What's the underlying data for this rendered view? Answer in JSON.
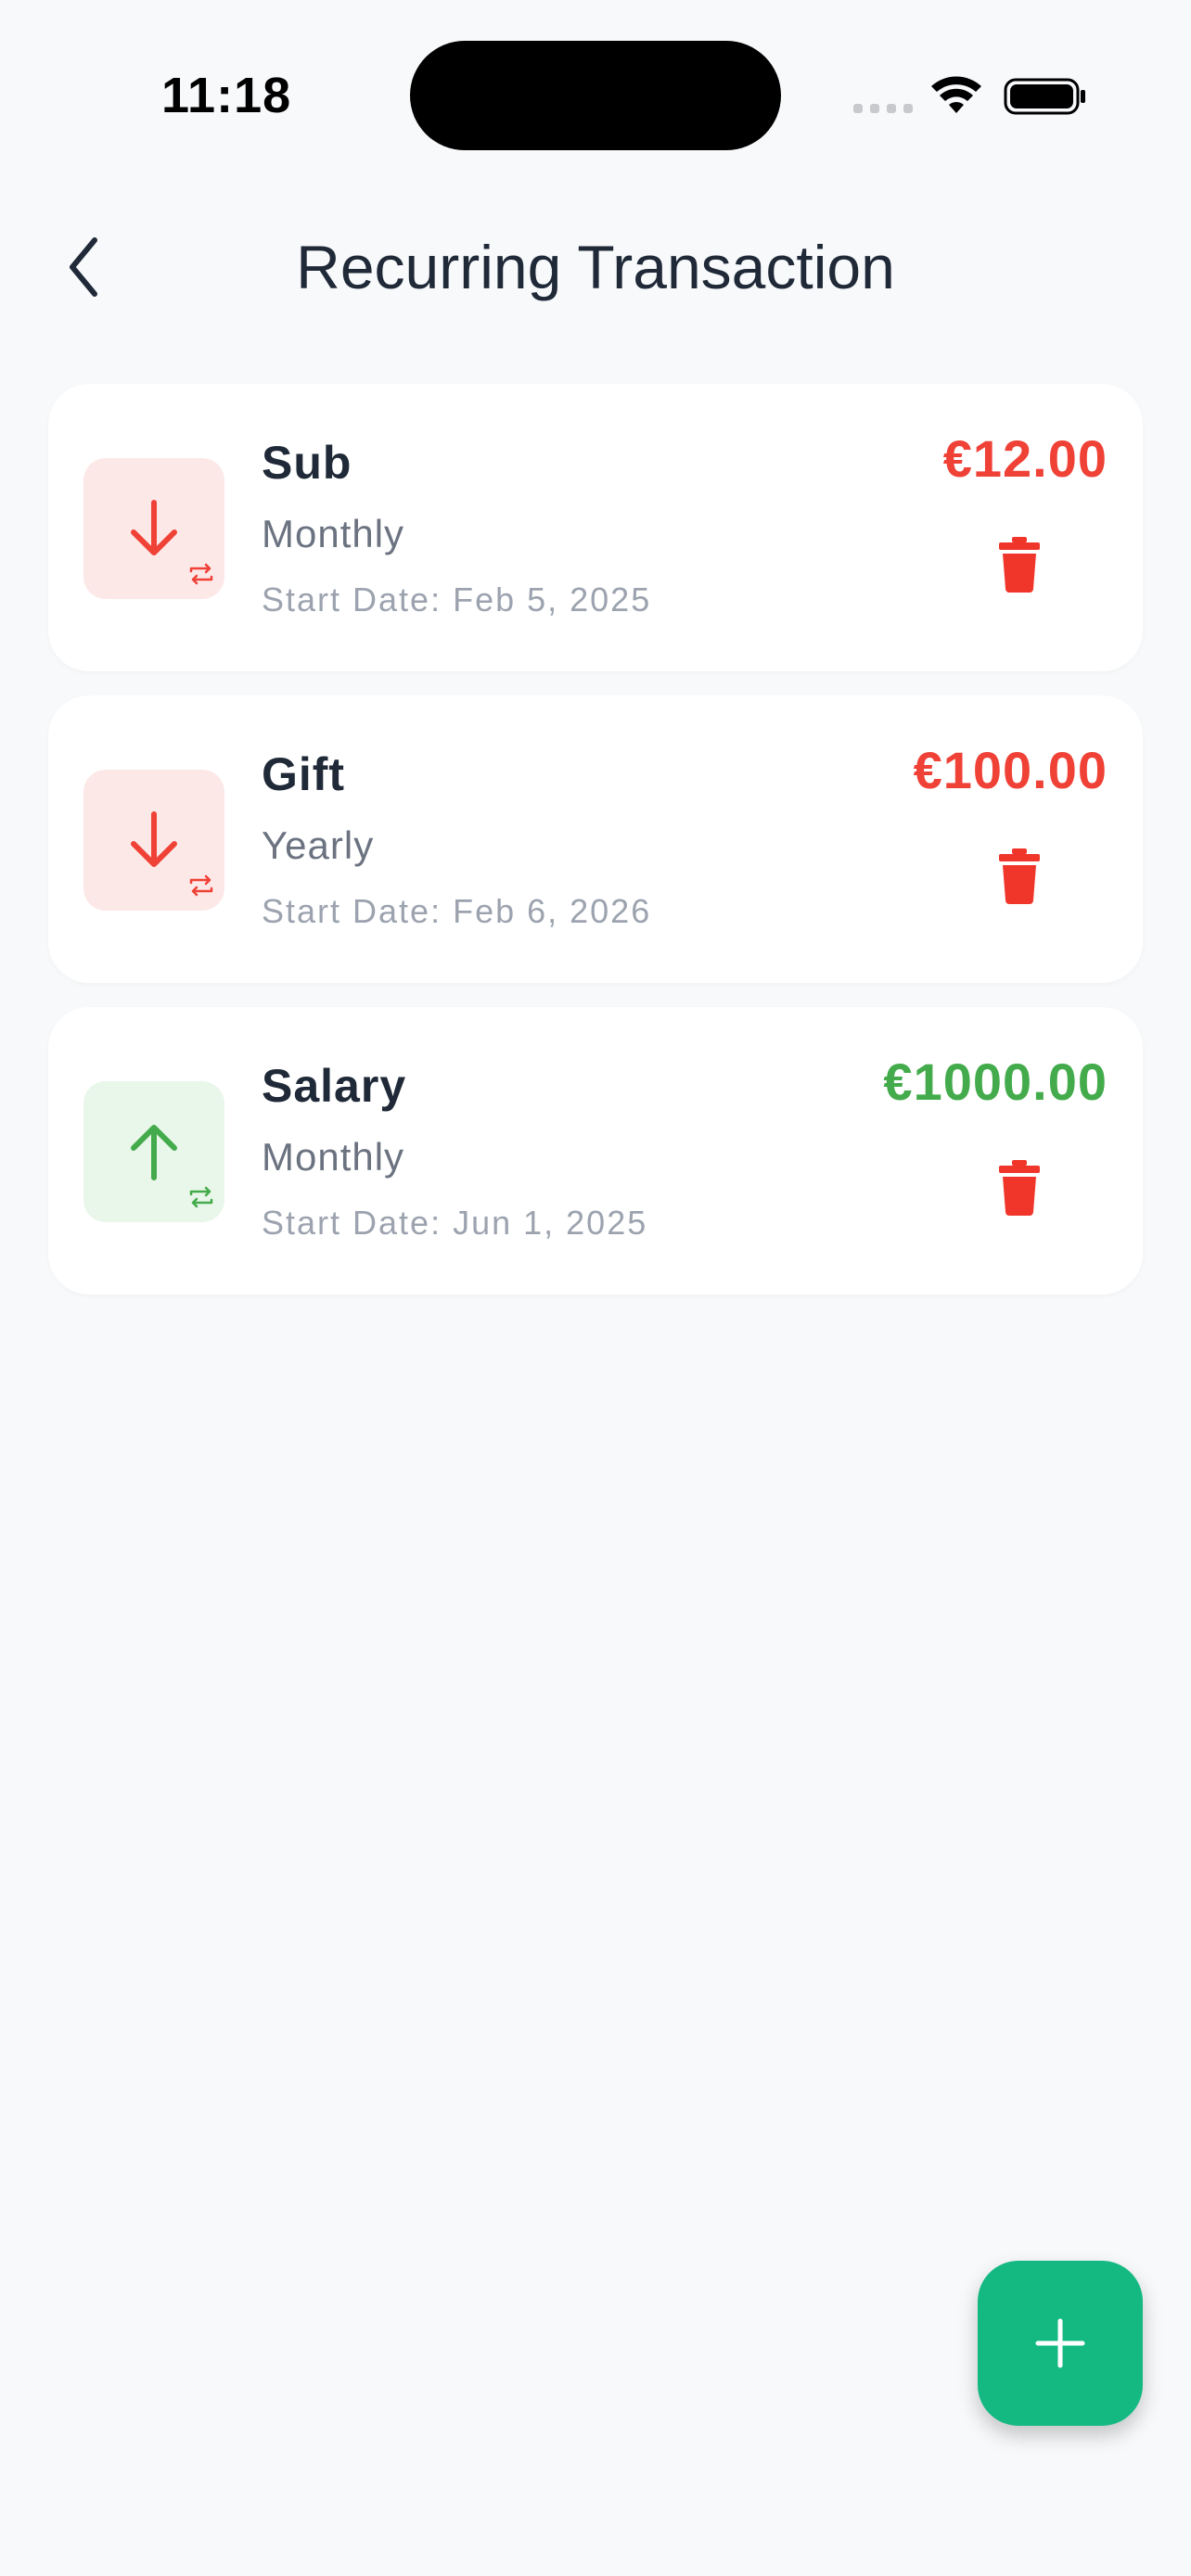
{
  "status_bar": {
    "time": "11:18"
  },
  "header": {
    "title": "Recurring Transaction"
  },
  "transactions": [
    {
      "name": "Sub",
      "frequency": "Monthly",
      "start_date": "Start Date: Feb 5, 2025",
      "amount": "€12.00",
      "type": "expense",
      "direction_icon": "arrow-down-icon"
    },
    {
      "name": "Gift",
      "frequency": "Yearly",
      "start_date": "Start Date: Feb 6, 2026",
      "amount": "€100.00",
      "type": "expense",
      "direction_icon": "arrow-down-icon"
    },
    {
      "name": "Salary",
      "frequency": "Monthly",
      "start_date": "Start Date: Jun 1, 2025",
      "amount": "€1000.00",
      "type": "income",
      "direction_icon": "arrow-up-icon"
    }
  ],
  "colors": {
    "background": "#f7f9fb",
    "card": "#ffffff",
    "expense": "#ef4136",
    "expense_bg": "#fde8e8",
    "income": "#43ab4b",
    "income_bg": "#e9f6ea",
    "fab": "#14b981",
    "delete": "#f0362b",
    "title": "#1f2937"
  },
  "fab": {
    "icon": "plus-icon"
  }
}
